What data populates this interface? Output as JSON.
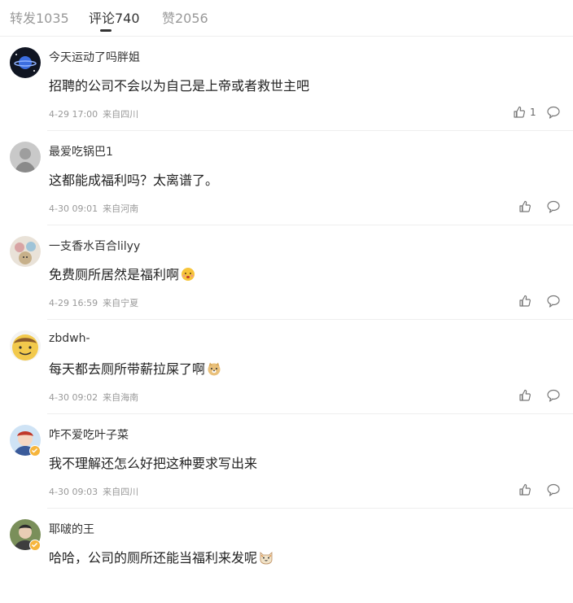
{
  "tabs": [
    {
      "label": "转发1035"
    },
    {
      "label": "评论740"
    },
    {
      "label": "赞2056"
    }
  ],
  "comments": [
    {
      "user": "今天运动了吗胖姐",
      "text": "招聘的公司不会以为自己是上帝或者救世主吧",
      "date": "4-29 17:00",
      "location": "来自四川",
      "likes": "1"
    },
    {
      "user": "最爱吃锅巴1",
      "text": "这都能成福利吗？太离谱了。",
      "date": "4-30 09:01",
      "location": "来自河南",
      "likes": ""
    },
    {
      "user": "一支香水百合lilyy",
      "text": "免费厕所居然是福利啊",
      "date": "4-29 16:59",
      "location": "来自宁夏",
      "likes": ""
    },
    {
      "user": "zbdwh-",
      "text": "每天都去厕所带薪拉屎了啊",
      "date": "4-30 09:02",
      "location": "来自海南",
      "likes": ""
    },
    {
      "user": "咋不爱吃叶子菜",
      "text": "我不理解还怎么好把这种要求写出来",
      "date": "4-30 09:03",
      "location": "来自四川",
      "likes": ""
    },
    {
      "user": "耶啵的王",
      "text": "哈哈，公司的厕所还能当福利来发呢",
      "date": "",
      "location": "",
      "likes": ""
    }
  ]
}
